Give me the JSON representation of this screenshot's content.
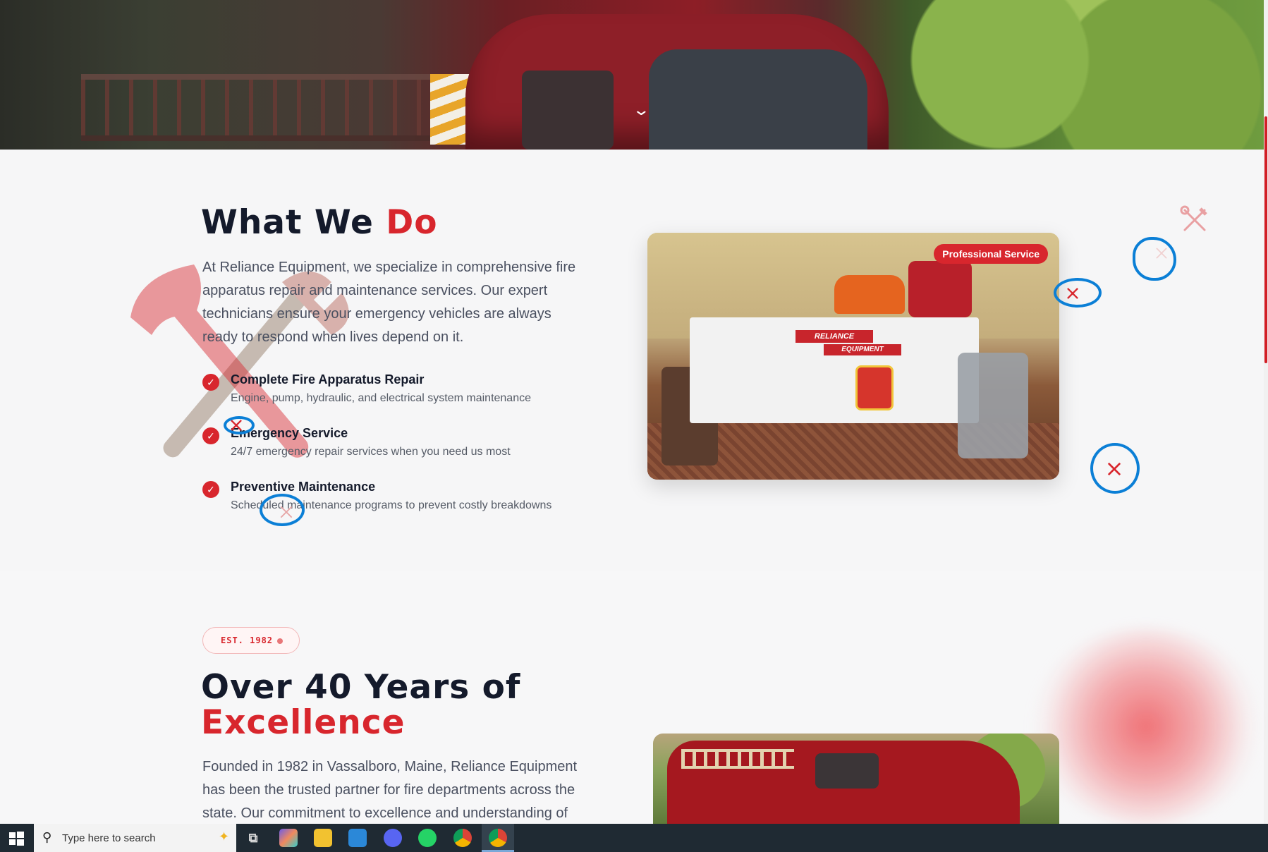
{
  "hero": {
    "scroll_hint_icon": "chevron-down-icon"
  },
  "what_we_do": {
    "title_part1": "What We ",
    "title_part2": "Do",
    "description_lines": [
      "At Reliance Equipment, we specialize in comprehensive fire",
      "apparatus repair and maintenance services. Our expert",
      "technicians ensure your emergency vehicles are always",
      "ready to respond when lives depend on it."
    ],
    "features": [
      {
        "title": "Complete Fire Apparatus Repair",
        "description": "Engine, pump, hydraulic, and electrical system maintenance"
      },
      {
        "title": "Emergency Service",
        "description": "24/7 emergency repair services when you need us most"
      },
      {
        "title": "Preventive Maintenance",
        "description": "Scheduled maintenance programs to prevent costly breakdowns"
      }
    ],
    "photo_tag": "Professional Service"
  },
  "history": {
    "badge": "EST. 1982",
    "title_line1": "Over 40 Years of",
    "title_line2": "Excellence",
    "description_lines": [
      "Founded in 1982 in Vassalboro, Maine, Reliance Equipment",
      "has been the trusted partner for fire departments across the",
      "state. Our commitment to excellence and understanding of"
    ]
  },
  "taskbar": {
    "search_placeholder": "Type here to search",
    "apps": [
      "windows-start-icon",
      "task-view-icon",
      "copilot-icon",
      "file-explorer-icon",
      "microsoft-store-icon",
      "discord-icon",
      "whatsapp-icon",
      "chrome-icon",
      "chrome-profile-icon"
    ]
  },
  "colors": {
    "accent": "#d8262d",
    "heading": "#141a2b",
    "annotation": "#0b7fd6"
  }
}
